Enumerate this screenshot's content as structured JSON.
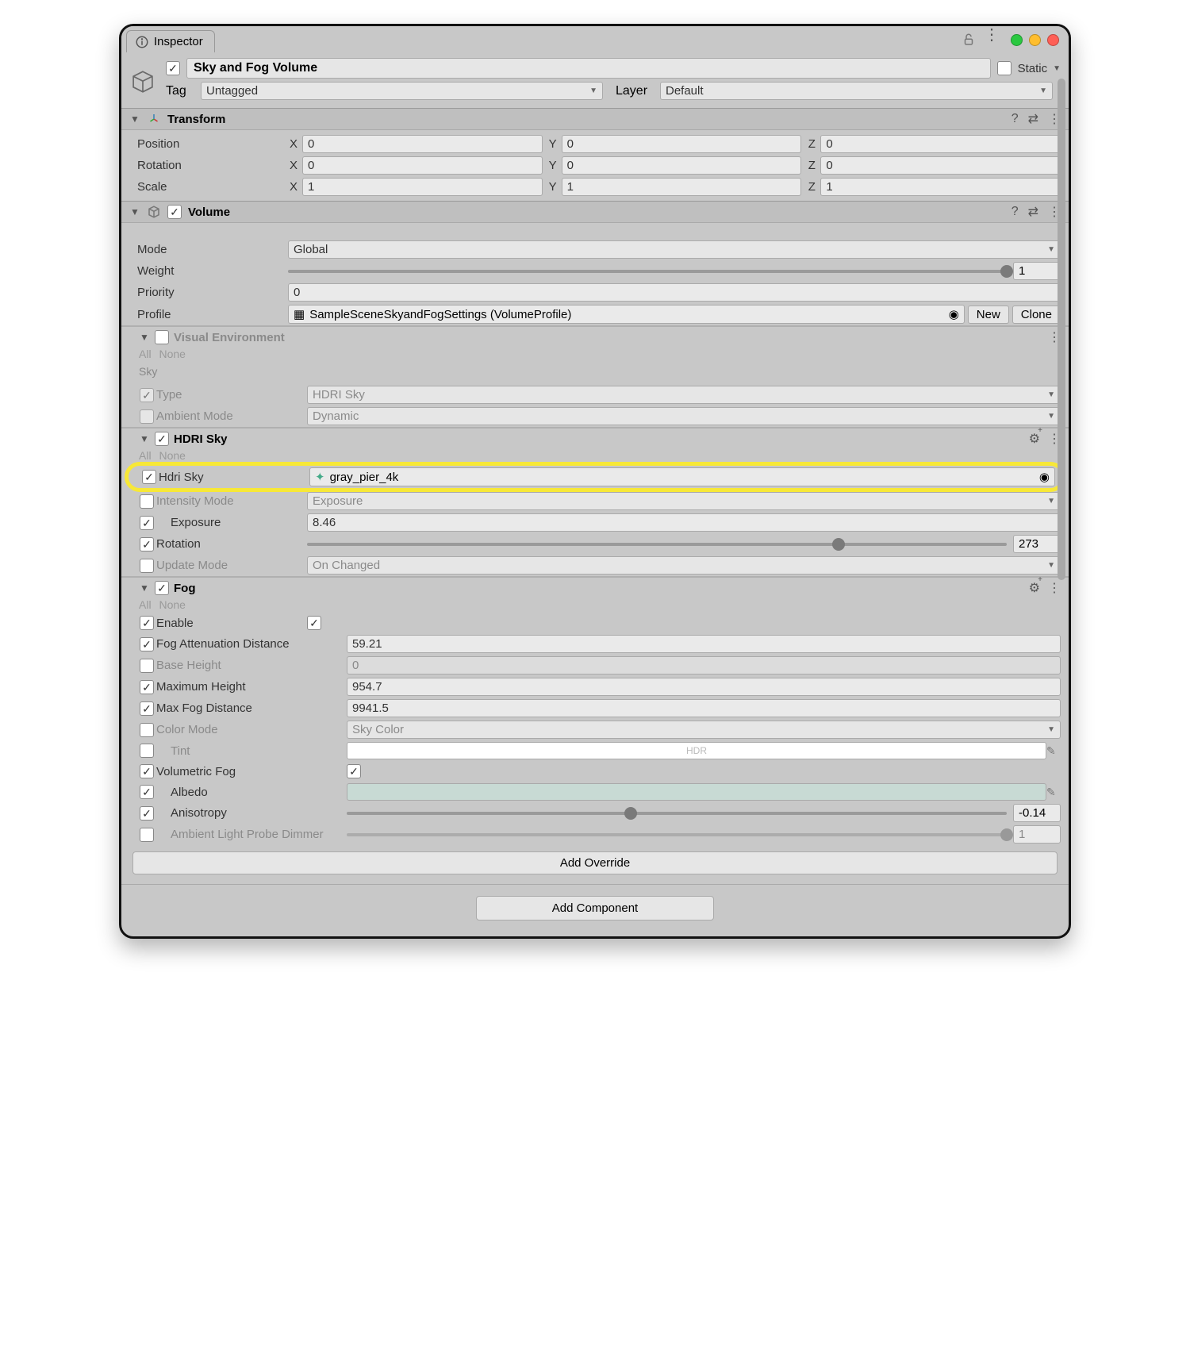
{
  "header": {
    "tab_title": "Inspector"
  },
  "gameobject": {
    "name": "Sky and Fog Volume",
    "enabled": true,
    "static_label": "Static",
    "tag_label": "Tag",
    "tag_value": "Untagged",
    "layer_label": "Layer",
    "layer_value": "Default"
  },
  "transform": {
    "title": "Transform",
    "position": {
      "label": "Position",
      "x": "0",
      "y": "0",
      "z": "0"
    },
    "rotation": {
      "label": "Rotation",
      "x": "0",
      "y": "0",
      "z": "0"
    },
    "scale": {
      "label": "Scale",
      "x": "1",
      "y": "1",
      "z": "1"
    }
  },
  "volume": {
    "title": "Volume",
    "enabled": true,
    "mode": {
      "label": "Mode",
      "value": "Global"
    },
    "weight": {
      "label": "Weight",
      "value": "1",
      "slider_pct": 100
    },
    "priority": {
      "label": "Priority",
      "value": "0"
    },
    "profile": {
      "label": "Profile",
      "value": "SampleSceneSkyandFogSettings (VolumeProfile)",
      "new_btn": "New",
      "clone_btn": "Clone"
    },
    "visual_env": {
      "title": "Visual Environment",
      "enabled": false,
      "all": "All",
      "none": "None",
      "sky_section": "Sky",
      "type": {
        "label": "Type",
        "value": "HDRI Sky",
        "checked": true
      },
      "ambient": {
        "label": "Ambient Mode",
        "value": "Dynamic",
        "checked": false
      }
    },
    "hdri": {
      "title": "HDRI Sky",
      "enabled": true,
      "all": "All",
      "none": "None",
      "sky_field": {
        "label": "Hdri Sky",
        "value": "gray_pier_4k",
        "checked": true
      },
      "intensity": {
        "label": "Intensity Mode",
        "value": "Exposure",
        "checked": false
      },
      "exposure": {
        "label": "Exposure",
        "value": "8.46",
        "checked": true
      },
      "rotation": {
        "label": "Rotation",
        "value": "273",
        "slider_pct": 76,
        "checked": true
      },
      "update": {
        "label": "Update Mode",
        "value": "On Changed",
        "checked": false
      }
    },
    "fog": {
      "title": "Fog",
      "enabled": true,
      "all": "All",
      "none": "None",
      "enable": {
        "label": "Enable",
        "checked": true,
        "on": true
      },
      "atten": {
        "label": "Fog Attenuation Distance",
        "value": "59.21",
        "checked": true
      },
      "base": {
        "label": "Base Height",
        "value": "0",
        "checked": false
      },
      "maxh": {
        "label": "Maximum Height",
        "value": "954.7",
        "checked": true
      },
      "maxdist": {
        "label": "Max Fog Distance",
        "value": "9941.5",
        "checked": true
      },
      "colormode": {
        "label": "Color Mode",
        "value": "Sky Color",
        "checked": false
      },
      "tint": {
        "label": "Tint",
        "hdr_label": "HDR",
        "checked": false
      },
      "volfog": {
        "label": "Volumetric Fog",
        "checked": true,
        "on": true
      },
      "albedo": {
        "label": "Albedo",
        "color": "#c8dad4",
        "checked": true
      },
      "aniso": {
        "label": "Anisotropy",
        "value": "-0.14",
        "slider_pct": 43,
        "checked": true
      },
      "ambientdim": {
        "label": "Ambient Light Probe Dimmer",
        "value": "1",
        "slider_pct": 100,
        "checked": false
      }
    }
  },
  "add_override": "Add Override",
  "add_component": "Add Component"
}
